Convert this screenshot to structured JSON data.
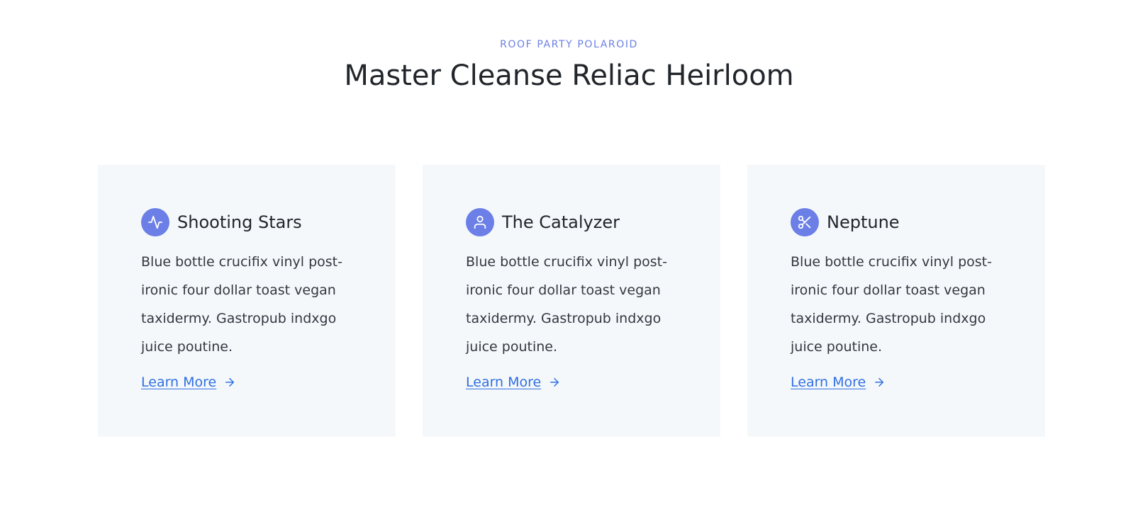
{
  "header": {
    "eyebrow": "ROOF PARTY POLAROID",
    "title": "Master Cleanse Reliac Heirloom"
  },
  "cards": [
    {
      "title": "Shooting Stars",
      "icon": "pulse-icon",
      "text": "Blue bottle crucifix vinyl post-ironic four dollar toast vegan taxidermy. Gastropub indxgo juice poutine.",
      "link": "Learn More"
    },
    {
      "title": "The Catalyzer",
      "icon": "user-icon",
      "text": "Blue bottle crucifix vinyl post-ironic four dollar toast vegan taxidermy. Gastropub indxgo juice poutine.",
      "link": "Learn More"
    },
    {
      "title": "Neptune",
      "icon": "scissors-icon",
      "text": "Blue bottle crucifix vinyl post-ironic four dollar toast vegan taxidermy. Gastropub indxgo juice poutine.",
      "link": "Learn More"
    }
  ],
  "colors": {
    "accent": "#6b7fe6",
    "link": "#2f6fe0",
    "card_bg": "#f5f8fb",
    "heading": "#22262b"
  }
}
